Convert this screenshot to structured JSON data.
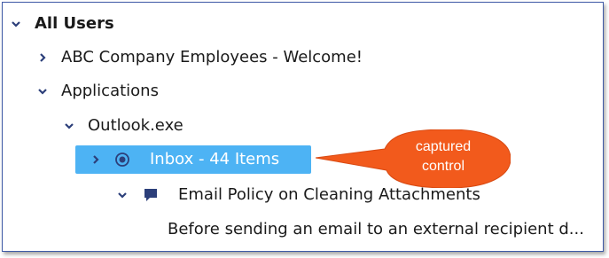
{
  "tree": {
    "root": {
      "label": "All Users"
    },
    "nodes": [
      {
        "label": "ABC Company Employees - Welcome!"
      },
      {
        "label": "Applications"
      },
      {
        "label": "Outlook.exe"
      },
      {
        "label": "Inbox - 44 Items"
      },
      {
        "label": "Email Policy on Cleaning Attachments"
      },
      {
        "label": "Before sending an email to an external recipient d..."
      }
    ]
  },
  "callout": {
    "line1": "captured",
    "line2": "control"
  },
  "colors": {
    "selection": "#4db3f4",
    "callout": "#f25a1c",
    "chevron": "#2c3f7a",
    "border": "#3f5aa6"
  },
  "icons": {
    "expanded": "chevron-down-icon",
    "collapsed": "chevron-right-icon",
    "selected_node": "radio-dot-icon",
    "message": "speech-bubble-icon"
  }
}
